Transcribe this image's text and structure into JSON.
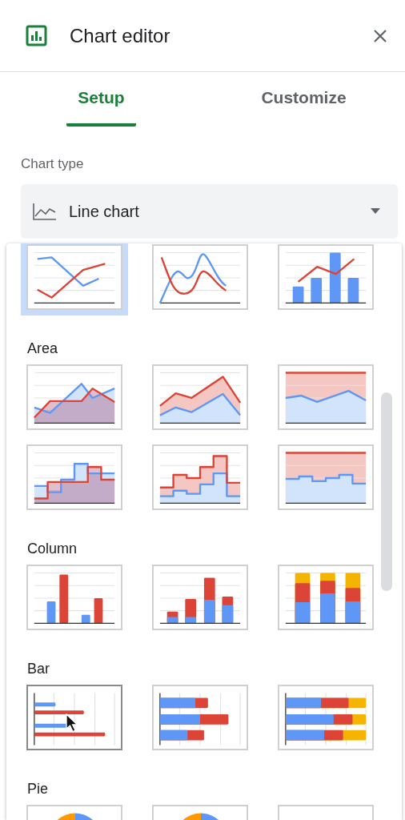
{
  "header": {
    "title": "Chart editor"
  },
  "tabs": [
    {
      "label": "Setup",
      "selected": true
    },
    {
      "label": "Customize",
      "selected": false
    }
  ],
  "chart_type": {
    "label": "Chart type",
    "value": "Line chart"
  },
  "groups": [
    {
      "items": [
        {
          "kind": "line",
          "selected": true,
          "hovered": false
        },
        {
          "kind": "smooth-line",
          "selected": false,
          "hovered": false
        },
        {
          "kind": "combo",
          "selected": false,
          "hovered": false
        }
      ]
    },
    {
      "label": "Area",
      "items": [
        {
          "kind": "area",
          "selected": false,
          "hovered": false
        },
        {
          "kind": "stacked-area",
          "selected": false,
          "hovered": false
        },
        {
          "kind": "full-area",
          "selected": false,
          "hovered": false
        },
        {
          "kind": "stepped-area",
          "selected": false,
          "hovered": false
        },
        {
          "kind": "stacked-stepped-area",
          "selected": false,
          "hovered": false
        },
        {
          "kind": "full-stepped-area",
          "selected": false,
          "hovered": false
        }
      ]
    },
    {
      "label": "Column",
      "items": [
        {
          "kind": "column",
          "selected": false,
          "hovered": false
        },
        {
          "kind": "stacked-column",
          "selected": false,
          "hovered": false
        },
        {
          "kind": "full-column",
          "selected": false,
          "hovered": false
        }
      ]
    },
    {
      "label": "Bar",
      "items": [
        {
          "kind": "bar",
          "selected": false,
          "hovered": true
        },
        {
          "kind": "stacked-bar",
          "selected": false,
          "hovered": false
        },
        {
          "kind": "full-bar",
          "selected": false,
          "hovered": false
        }
      ]
    },
    {
      "label": "Pie",
      "items": [
        {
          "kind": "pie",
          "selected": false,
          "hovered": false
        },
        {
          "kind": "donut",
          "selected": false,
          "hovered": false
        },
        {
          "kind": "pie-3d",
          "selected": false,
          "hovered": false
        }
      ]
    }
  ]
}
